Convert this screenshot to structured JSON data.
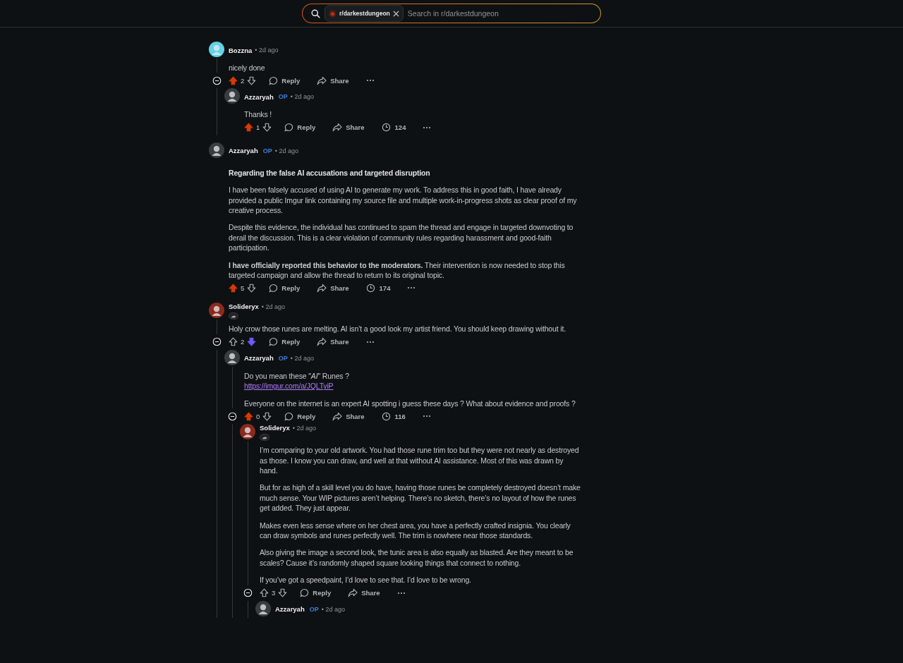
{
  "search": {
    "community": "r/darkestdungeon",
    "placeholder": "Search in r/darkestdungeon"
  },
  "comments": [
    {
      "author": "Bozzna",
      "color": "#62d3e6",
      "flair": false,
      "time": "• 2d ago",
      "body": [
        {
          "kind": "text",
          "text": "nicely done"
        }
      ],
      "upvoted": true,
      "downvoted": false,
      "score": "2",
      "reply_label": "Reply",
      "share_label": "Share",
      "children": [
        {
          "author": "Azzaryah",
          "color": "#3a3d40",
          "op_label": "OP",
          "flair": false,
          "time": "• 2d ago",
          "body": [
            {
              "kind": "text",
              "text": "Thanks !"
            }
          ],
          "upvoted": true,
          "downvoted": false,
          "score": "1",
          "reply_label": "Reply",
          "share_label": "Share",
          "views": "124"
        }
      ]
    },
    {
      "author": "Azzaryah",
      "color": "#3a3d40",
      "op_label": "OP",
      "flair": false,
      "time": "• 2d ago",
      "body": [
        {
          "kind": "heading",
          "text": "Regarding the false AI accusations and targeted disruption"
        },
        {
          "kind": "text",
          "text": "I have been falsely accused of using AI to generate my work. To address this in good faith, I have already provided a public Imgur link containing my source file and multiple work-in-progress shots as clear proof of my creative process."
        },
        {
          "kind": "text",
          "text": "Despite this evidence, the individual has continued to spam the thread and engage in targeted downvoting to derail the discussion. This is a clear violation of community rules regarding harassment and good-faith participation."
        },
        {
          "kind": "text",
          "text": "**I have officially reported this behavior to the moderators.** Their intervention is now needed to stop this targeted campaign and allow the thread to return to its original topic."
        }
      ],
      "upvoted": true,
      "downvoted": false,
      "score": "5",
      "reply_label": "Reply",
      "share_label": "Share",
      "views": "174"
    },
    {
      "author": "Solideryx",
      "color": "#8a2a1e",
      "flair": true,
      "time": "• 2d ago",
      "body": [
        {
          "kind": "text",
          "text": "Holy crow those runes are melting. AI isn’t a good look my artist friend. You should keep drawing without it."
        }
      ],
      "upvoted": false,
      "downvoted": true,
      "score": "2",
      "reply_label": "Reply",
      "share_label": "Share",
      "children": [
        {
          "author": "Azzaryah",
          "color": "#3a3d40",
          "op_label": "OP",
          "flair": false,
          "time": "• 2d ago",
          "body": [
            {
              "kind": "text",
              "text": "Do you mean these \"*AI*\" Runes ?"
            },
            {
              "kind": "link",
              "text": "https://imgur.com/a/JQLTyiP"
            },
            {
              "kind": "text",
              "text": "Everyone on the internet is an expert AI spotting i guess these days ? What about evidence and proofs ?"
            }
          ],
          "upvoted": true,
          "downvoted": false,
          "score": "0",
          "reply_label": "Reply",
          "share_label": "Share",
          "views": "116",
          "children": [
            {
              "author": "Solideryx",
              "color": "#8a2a1e",
              "flair": true,
              "time": "• 2d ago",
              "body": [
                {
                  "kind": "text",
                  "text": "I’m comparing to your old artwork. You had those rune trim too but they were not nearly as destroyed as those. I know you can draw, and well at that without AI assistance. Most of this was drawn by hand."
                },
                {
                  "kind": "text",
                  "text": "But for as high of a skill level you do have, having those runes be completely destroyed doesn’t make much sense. Your WIP pictures aren’t helping. There’s no sketch, there’s no layout of how the runes get added. They just appear."
                },
                {
                  "kind": "text",
                  "text": "Makes even less sense where on her chest area, you have a perfectly crafted insignia. You clearly can draw symbols and runes perfectly well. The trim is nowhere near those standards."
                },
                {
                  "kind": "text",
                  "text": "Also giving the image a second look, the tunic area is also equally as blasted. Are they meant to be scales? Cause it’s randomly shaped square looking things that connect to nothing."
                },
                {
                  "kind": "text",
                  "text": "If you’ve got a speedpaint, I’d love to see that. I’d love to be wrong."
                }
              ],
              "upvoted": false,
              "downvoted": false,
              "score": "3",
              "reply_label": "Reply",
              "share_label": "Share",
              "children": [
                {
                  "author": "Azzaryah",
                  "color": "#3a3d40",
                  "op_label": "OP",
                  "flair": false,
                  "time": "• 2d ago"
                }
              ]
            }
          ]
        }
      ]
    }
  ]
}
